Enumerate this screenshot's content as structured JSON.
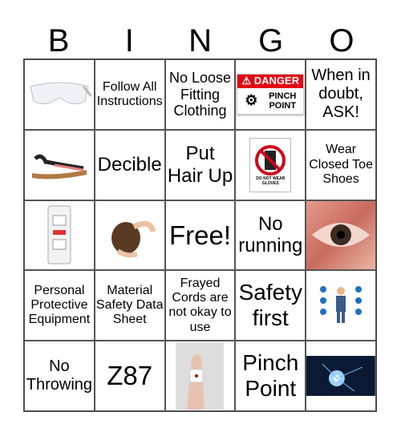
{
  "header": [
    "B",
    "I",
    "N",
    "G",
    "O"
  ],
  "cells": [
    {
      "text": "",
      "icon": "safety-glasses-image"
    },
    {
      "text": "Follow All Instructions"
    },
    {
      "text": "No Loose Fitting Clothing"
    },
    {
      "text": "",
      "icon": "danger-pinch-point-sign",
      "sign": {
        "title": "DANGER",
        "line1": "PINCH",
        "line2": "POINT"
      }
    },
    {
      "text": "When in doubt, ASK!"
    },
    {
      "text": "",
      "icon": "sandal-image"
    },
    {
      "text": "Decible"
    },
    {
      "text": "Put Hair Up"
    },
    {
      "text": "",
      "icon": "no-gloves-sign",
      "sign": {
        "line1": "DO NOT WEAR",
        "line2": "GLOVES"
      }
    },
    {
      "text": "Wear Closed Toe Shoes"
    },
    {
      "text": "",
      "icon": "gfci-outlet-image"
    },
    {
      "text": "",
      "icon": "hair-tie-image"
    },
    {
      "text": "Free!"
    },
    {
      "text": "No running"
    },
    {
      "text": "",
      "icon": "eye-closeup-image"
    },
    {
      "text": "Personal Protective Equipment"
    },
    {
      "text": "Material Safety Data Sheet"
    },
    {
      "text": "Frayed Cords are not okay to use"
    },
    {
      "text": "Safety first"
    },
    {
      "text": "",
      "icon": "ppe-worker-icons-image"
    },
    {
      "text": "No Throwing"
    },
    {
      "text": "Z87"
    },
    {
      "text": "",
      "icon": "bandaged-finger-image"
    },
    {
      "text": "Pinch Point"
    },
    {
      "text": "",
      "icon": "welding-image"
    }
  ],
  "colors": {
    "danger": "#e30613",
    "no_sign": "#d0021b"
  }
}
